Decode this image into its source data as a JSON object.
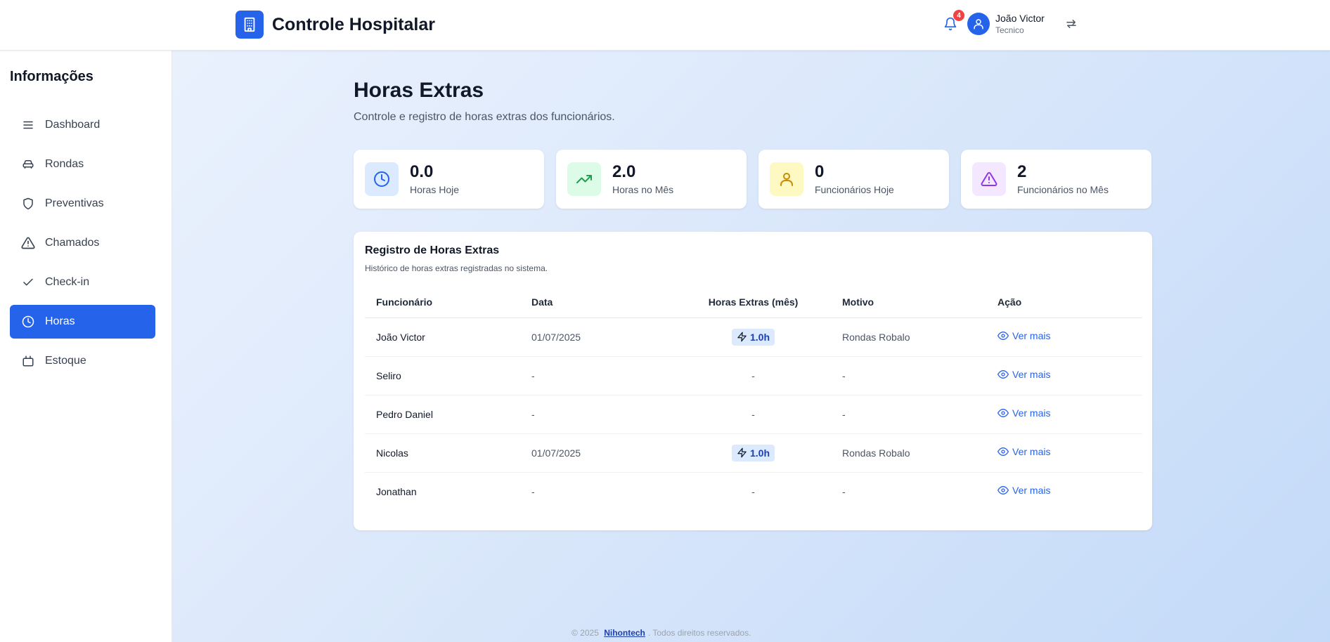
{
  "header": {
    "title": "Controle Hospitalar",
    "logo_icon": "building-icon",
    "notifications_count": "4",
    "user": {
      "name": "João Victor",
      "role": "Tecnico"
    }
  },
  "sidebar": {
    "title": "Informações",
    "items": [
      {
        "label": "Dashboard",
        "icon": "menu-icon",
        "active": false
      },
      {
        "label": "Rondas",
        "icon": "car-icon",
        "active": false
      },
      {
        "label": "Preventivas",
        "icon": "shield-icon",
        "active": false
      },
      {
        "label": "Chamados",
        "icon": "alert-triangle-icon",
        "active": false
      },
      {
        "label": "Check-in",
        "icon": "check-icon",
        "active": false
      },
      {
        "label": "Horas",
        "icon": "clock-icon",
        "active": true
      },
      {
        "label": "Estoque",
        "icon": "box-icon",
        "active": false
      }
    ]
  },
  "page": {
    "title": "Horas Extras",
    "subtitle": "Controle e registro de horas extras dos funcionários."
  },
  "stats": [
    {
      "value": "0.0",
      "label": "Horas Hoje",
      "icon": "clock-icon",
      "color": "#2563eb",
      "bg": "#dbeafe"
    },
    {
      "value": "2.0",
      "label": "Horas no Mês",
      "icon": "trending-up-icon",
      "color": "#16a34a",
      "bg": "#dcfce7"
    },
    {
      "value": "0",
      "label": "Funcionários Hoje",
      "icon": "user-icon",
      "color": "#ca8a04",
      "bg": "#fef9c3"
    },
    {
      "value": "2",
      "label": "Funcionários no Mês",
      "icon": "alert-triangle-icon",
      "color": "#9333ea",
      "bg": "#f3e8ff"
    }
  ],
  "table": {
    "title": "Registro de Horas Extras",
    "description": "Histórico de horas extras registradas no sistema.",
    "columns": [
      "Funcionário",
      "Data",
      "Horas Extras (mês)",
      "Motivo",
      "Ação"
    ],
    "rows": [
      {
        "name": "João Victor",
        "date": "01/07/2025",
        "hours": "1.0h",
        "reason": "Rondas Robalo",
        "action": "Ver mais"
      },
      {
        "name": "Seliro",
        "date": "-",
        "hours": "-",
        "reason": "-",
        "action": "Ver mais"
      },
      {
        "name": "Pedro Daniel",
        "date": "-",
        "hours": "-",
        "reason": "-",
        "action": "Ver mais"
      },
      {
        "name": "Nicolas",
        "date": "01/07/2025",
        "hours": "1.0h",
        "reason": "Rondas Robalo",
        "action": "Ver mais"
      },
      {
        "name": "Jonathan",
        "date": "-",
        "hours": "-",
        "reason": "-",
        "action": "Ver mais"
      }
    ]
  },
  "footer": {
    "prefix": "© 2025",
    "link": "Nihontech",
    "suffix": ". Todos direitos reservados."
  },
  "colors": {
    "accent": "#2563eb",
    "badge": "#ef4444"
  }
}
